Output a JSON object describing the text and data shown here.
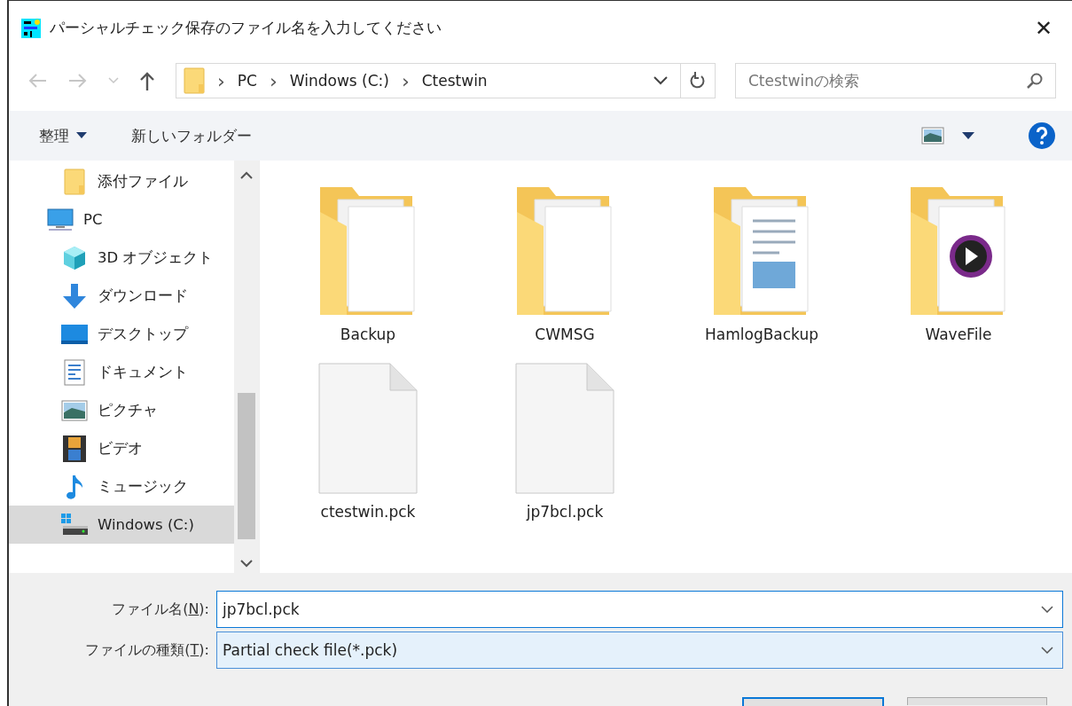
{
  "window": {
    "title": "パーシャルチェック保存のファイル名を入力してください",
    "close": "✕"
  },
  "address": {
    "crumbs": [
      "PC",
      "Windows (C:)",
      "Ctestwin"
    ],
    "separator": "›"
  },
  "search": {
    "placeholder": "Ctestwinの検索"
  },
  "toolbar": {
    "organize": "整理",
    "new_folder": "新しいフォルダー"
  },
  "nav": [
    {
      "children": [
        {
          "label": "添付ファイル",
          "kind": "folder",
          "selected": false
        }
      ]
    },
    {
      "label": "PC",
      "kind": "pc",
      "selected": false,
      "children": [
        {
          "label": "3D オブジェクト",
          "kind": "cube",
          "selected": false
        },
        {
          "label": "ダウンロード",
          "kind": "download",
          "selected": false
        },
        {
          "label": "デスクトップ",
          "kind": "desktop",
          "selected": false
        },
        {
          "label": "ドキュメント",
          "kind": "document",
          "selected": false
        },
        {
          "label": "ピクチャ",
          "kind": "picture",
          "selected": false
        },
        {
          "label": "ビデオ",
          "kind": "video",
          "selected": false
        },
        {
          "label": "ミュージック",
          "kind": "music",
          "selected": false
        },
        {
          "label": "Windows (C:)",
          "kind": "drive",
          "selected": true
        }
      ]
    }
  ],
  "files": [
    {
      "name": "Backup",
      "kind": "folder"
    },
    {
      "name": "CWMSG",
      "kind": "folder"
    },
    {
      "name": "HamlogBackup",
      "kind": "document-folder"
    },
    {
      "name": "WaveFile",
      "kind": "media-folder"
    },
    {
      "name": "ctestwin.pck",
      "kind": "file"
    },
    {
      "name": "jp7bcl.pck",
      "kind": "file"
    }
  ],
  "fields": [
    {
      "label_before": "ファイル名(",
      "accel": "N",
      "label_after": "):",
      "value": "jp7bcl.pck",
      "kind": "text"
    },
    {
      "label_before": "ファイルの種類(",
      "accel": "T",
      "label_after": "):",
      "value": "Partial check file(*.pck)",
      "kind": "dropdown"
    }
  ]
}
